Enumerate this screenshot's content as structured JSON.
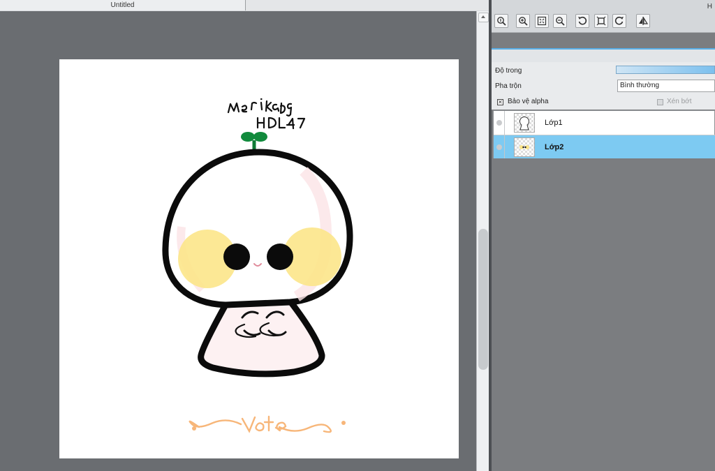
{
  "document": {
    "tab_title": "Untitled"
  },
  "artwork": {
    "signature_text": "Merikapg HDL47",
    "footer_text": "vote"
  },
  "toolbar": {
    "corner_label": "H",
    "buttons": [
      {
        "icon": "zoom-actual-icon"
      },
      {
        "icon": "zoom-in-icon"
      },
      {
        "icon": "fit-window-icon"
      },
      {
        "icon": "zoom-out-icon"
      },
      {
        "icon": "rotate-left-icon"
      },
      {
        "icon": "reset-view-icon"
      },
      {
        "icon": "rotate-right-icon"
      },
      {
        "icon": "flip-horizontal-icon"
      }
    ]
  },
  "layer_panel": {
    "opacity_label": "Độ trong",
    "blend_label": "Pha trộn",
    "blend_value": "Bình thường",
    "protect_alpha_label": "Bảo vệ alpha",
    "protect_alpha_checked": true,
    "clipping_label": "Xén bớt",
    "clipping_checked": false,
    "layers": [
      {
        "name": "Lớp1",
        "selected": false
      },
      {
        "name": "Lớp2",
        "selected": true
      }
    ]
  },
  "colors": {
    "selection": "#7dcaf2",
    "canvas_bg": "#6a6d71",
    "accent": "#5ab0e8"
  }
}
